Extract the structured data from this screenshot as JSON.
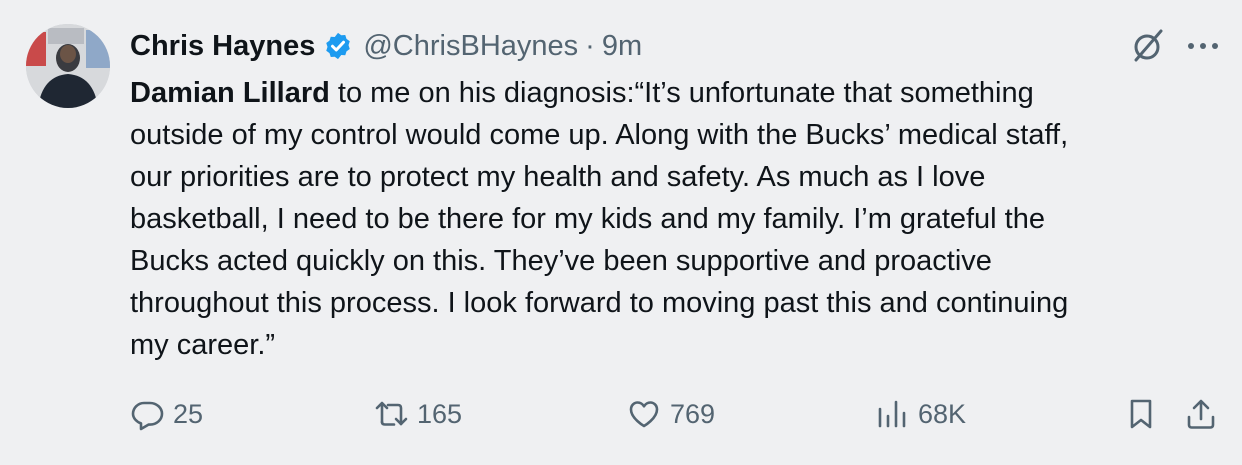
{
  "author": {
    "name": "Chris Haynes",
    "handle": "@ChrisBHaynes",
    "separator": "·",
    "time": "9m"
  },
  "tweet": {
    "mention": "Damian Lillard",
    "line1_rest": " to me on his diagnosis:“It’s unfortunate that something",
    "line2": "outside of my control would come up. Along with the Bucks’ medical staff,",
    "line3": "our priorities are to protect my health and safety. As much as I love",
    "line4": "basketball, I need to be there for my kids and my family. I’m grateful the",
    "line5": "Bucks acted quickly on this. They’ve been supportive and proactive",
    "line6": "throughout this process. I look forward to moving past this and continuing",
    "line7": "my career.”"
  },
  "stats": {
    "replies": "25",
    "retweets": "165",
    "likes": "769",
    "views": "68K"
  },
  "icons": {
    "verified": "verified-badge-icon",
    "grok": "grok-slash-icon",
    "more": "more-dots-icon",
    "reply": "reply-bubble-icon",
    "retweet": "retweet-icon",
    "like": "heart-icon",
    "views": "views-bars-icon",
    "bookmark": "bookmark-icon",
    "share": "share-upload-icon"
  },
  "colors": {
    "background": "#eff0f2",
    "text": "#0f1419",
    "secondary": "#536471",
    "verified": "#1d9bf0"
  }
}
